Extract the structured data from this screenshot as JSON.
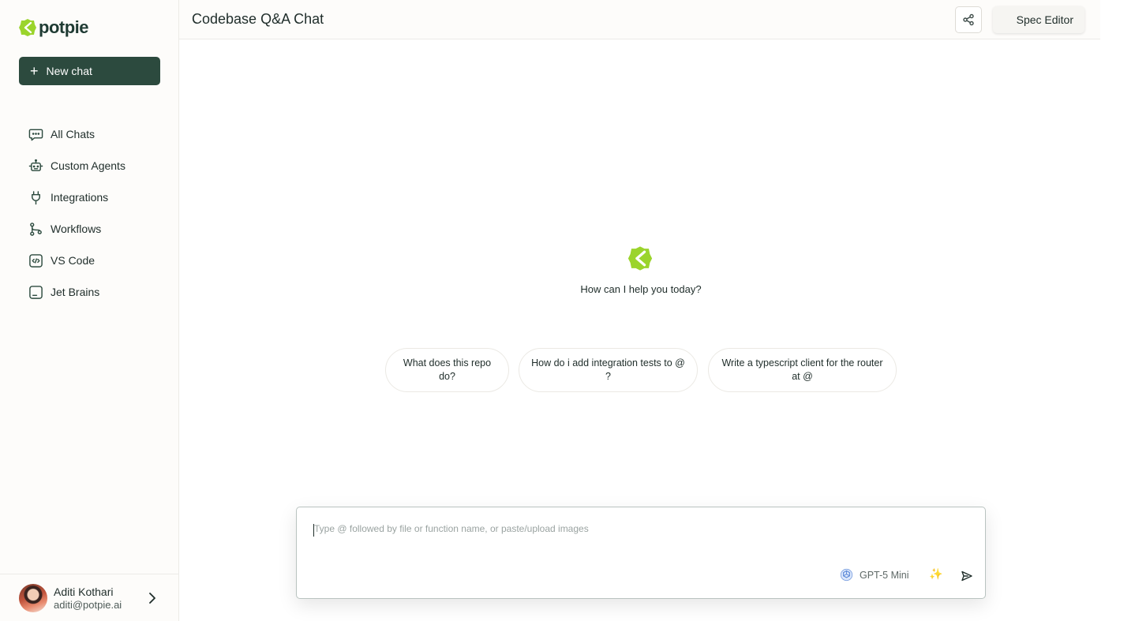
{
  "brand": {
    "name": "potpie",
    "logo_color": "#9bd42c"
  },
  "sidebar": {
    "new_chat_label": "New chat",
    "items": [
      {
        "label": "All Chats",
        "icon": "message-square-icon"
      },
      {
        "label": "Custom Agents",
        "icon": "bot-icon"
      },
      {
        "label": "Integrations",
        "icon": "plug-icon"
      },
      {
        "label": "Workflows",
        "icon": "git-branch-icon"
      },
      {
        "label": "VS Code",
        "icon": "code-square-icon"
      },
      {
        "label": "Jet Brains",
        "icon": "jetbrains-icon"
      }
    ],
    "user": {
      "name": "Aditi Kothari",
      "email": "aditi@potpie.ai"
    }
  },
  "header": {
    "title": "Codebase Q&A Chat",
    "spec_editor_label": "Spec Editor"
  },
  "main": {
    "greeting": "How can I help you today?",
    "suggestions": [
      "What does this repo do?",
      "How do i add integration tests to @ ?",
      "Write a typescript client for the router at @"
    ]
  },
  "composer": {
    "placeholder": "Type @ followed by file or function name, or paste/upload images",
    "value": "",
    "model_label": "GPT-5 Mini"
  },
  "colors": {
    "primary": "#2c4a3e",
    "accent": "#9bd42c",
    "border": "#ecebe7"
  }
}
